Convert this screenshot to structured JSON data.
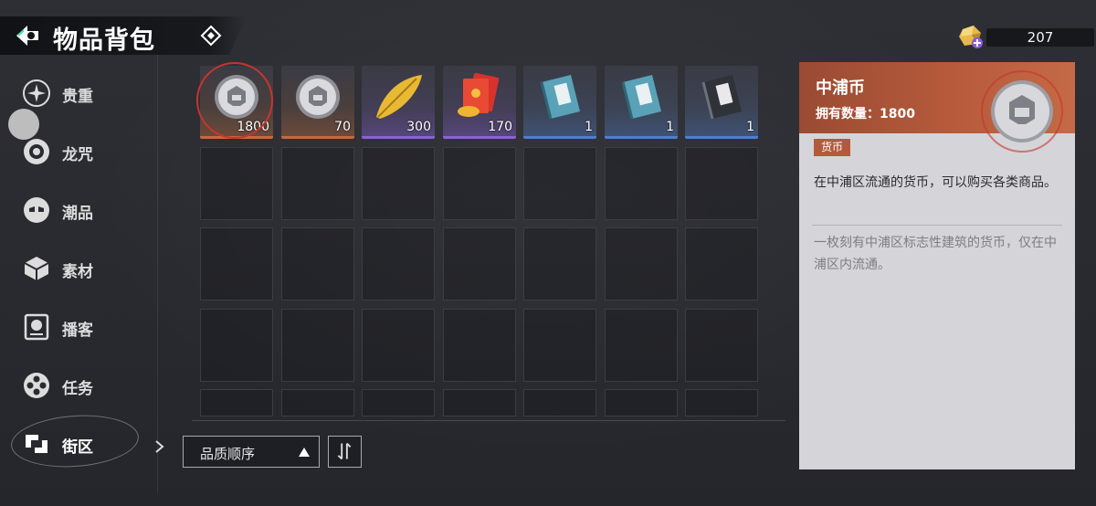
{
  "header": {
    "title": "物品背包"
  },
  "currency": {
    "value": "207",
    "icon": "premium-currency-icon"
  },
  "sidebar": {
    "items": [
      {
        "label": "贵重",
        "icon": "sparkle-icon"
      },
      {
        "label": "龙咒",
        "icon": "eye-icon"
      },
      {
        "label": "潮品",
        "icon": "mask-icon"
      },
      {
        "label": "素材",
        "icon": "cube-icon"
      },
      {
        "label": "播客",
        "icon": "radio-icon"
      },
      {
        "label": "任务",
        "icon": "film-reel-icon"
      },
      {
        "label": "街区",
        "icon": "block-icon"
      }
    ],
    "active_index": 6
  },
  "inventory": {
    "items": [
      {
        "name": "coin",
        "count": "1800",
        "quality": "orange",
        "color": "#c9683f"
      },
      {
        "name": "coin",
        "count": "70",
        "quality": "orange",
        "color": "#c9683f"
      },
      {
        "name": "golden-feather",
        "count": "300",
        "quality": "purple",
        "color": "#8b62d6"
      },
      {
        "name": "red-envelopes",
        "count": "170",
        "quality": "purple",
        "color": "#8b62d6"
      },
      {
        "name": "book",
        "count": "1",
        "quality": "blue",
        "color": "#4b7fd1"
      },
      {
        "name": "book",
        "count": "1",
        "quality": "blue",
        "color": "#4b7fd1"
      },
      {
        "name": "dark-book",
        "count": "1",
        "quality": "blue",
        "color": "#4b7fd1"
      }
    ],
    "selected_index": 0
  },
  "sort": {
    "label": "品质顺序"
  },
  "detail": {
    "name": "中浦币",
    "owned": "拥有数量：1800",
    "tag": "货币",
    "description": "在中浦区流通的货币，可以购买各类商品。",
    "lore": "一枚刻有中浦区标志性建筑的货币，仅在中浦区内流通。"
  },
  "colors": {
    "accent": "#b45a3c",
    "panel_bg": "#d5d5d9",
    "select_ring": "#c8342f"
  }
}
